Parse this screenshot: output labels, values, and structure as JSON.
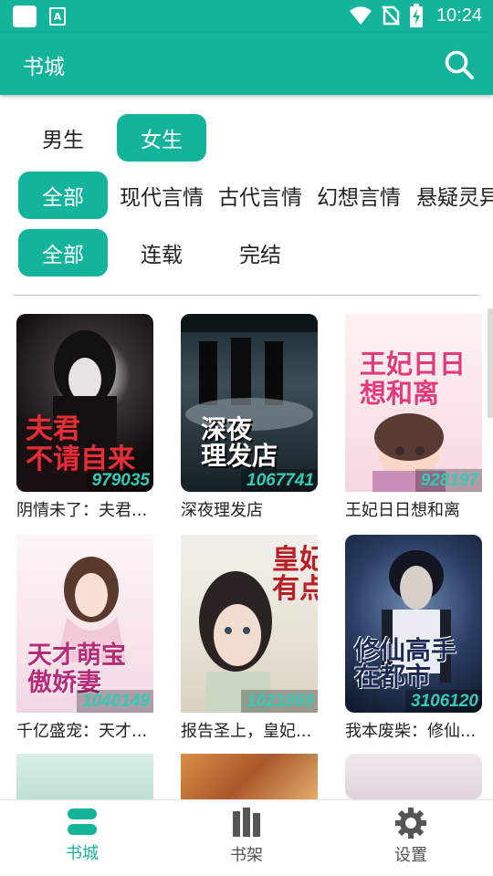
{
  "status": {
    "time": "10:24",
    "icons": [
      "app-square-icon",
      "app-a-icon",
      "wifi-icon",
      "no-sim-icon",
      "battery-charging-icon"
    ]
  },
  "appbar": {
    "title": "书城",
    "search_icon": "search-icon"
  },
  "gender_tabs": [
    {
      "label": "男生",
      "active": false
    },
    {
      "label": "女生",
      "active": true
    }
  ],
  "category_tabs": [
    {
      "label": "全部",
      "active": true
    },
    {
      "label": "现代言情",
      "active": false
    },
    {
      "label": "古代言情",
      "active": false
    },
    {
      "label": "幻想言情",
      "active": false
    },
    {
      "label": "悬疑灵异",
      "active": false
    }
  ],
  "status_tabs": [
    {
      "label": "全部",
      "active": true
    },
    {
      "label": "连载",
      "active": false
    },
    {
      "label": "完结",
      "active": false
    }
  ],
  "books": [
    {
      "title": "阴情未了：夫君...",
      "count": "979035",
      "cover_text": "夫君\n不请自来"
    },
    {
      "title": "深夜理发店",
      "count": "1067741",
      "cover_text": "深夜\n理发店"
    },
    {
      "title": "王妃日日想和离",
      "count": "928197",
      "cover_text": "王妃日日\n想和离"
    },
    {
      "title": "千亿盛宠：天才...",
      "count": "1040149",
      "cover_text": "天才萌宝\n傲娇妻"
    },
    {
      "title": "报告圣上，皇妃...",
      "count": "1021869",
      "cover_text": "皇妃\n有点傻"
    },
    {
      "title": "我本废柴：修仙...",
      "count": "3106120",
      "cover_text": "修仙高手\n在都市"
    }
  ],
  "bottom_nav": [
    {
      "label": "书城",
      "icon": "bookstore-icon",
      "active": true
    },
    {
      "label": "书架",
      "icon": "bookshelf-icon",
      "active": false
    },
    {
      "label": "设置",
      "icon": "gear-icon",
      "active": false
    }
  ],
  "colors": {
    "accent": "#14b39b",
    "count_text": "#36c9b6"
  }
}
